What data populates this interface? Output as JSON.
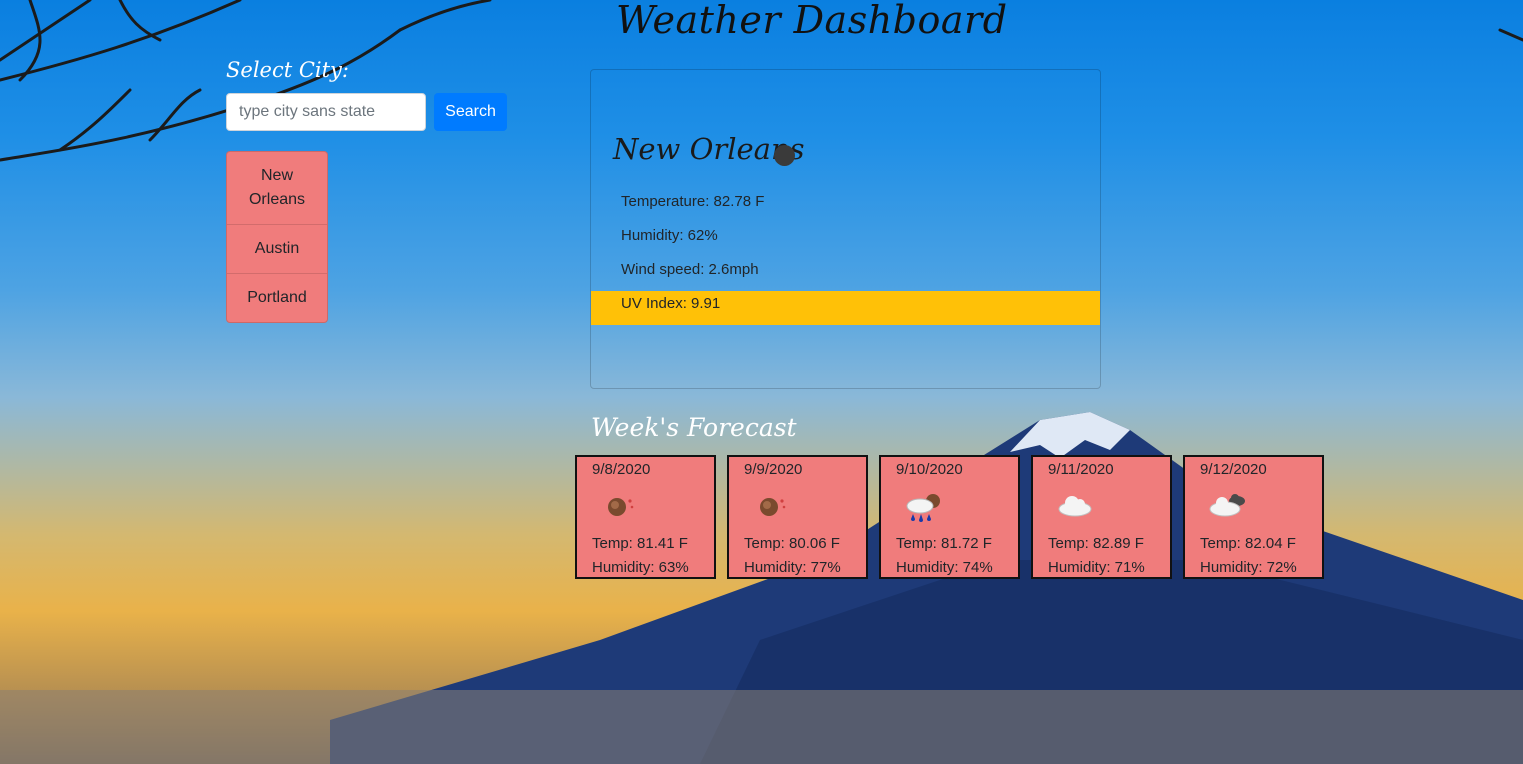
{
  "header": {
    "title": "Weather Dashboard"
  },
  "sidebar": {
    "label": "Select City:",
    "search_placeholder": "type city sans state",
    "search_value": "",
    "search_button": "Search",
    "cities": [
      "New Orleans",
      "Austin",
      "Portland"
    ]
  },
  "current": {
    "city": "New Orleans",
    "icon": "dark-circle-icon",
    "temperature": "Temperature: 82.78 F",
    "humidity": "Humidity: 62%",
    "wind": "Wind speed: 2.6mph",
    "uv": "UV Index: 9.91",
    "uv_color": "#ffc107"
  },
  "forecast": {
    "title": "Week's Forecast",
    "days": [
      {
        "date": "9/8/2020",
        "icon": "haze-icon",
        "temp": "Temp: 81.41 F",
        "humidity": "Humidity: 63%"
      },
      {
        "date": "9/9/2020",
        "icon": "haze-icon",
        "temp": "Temp: 80.06 F",
        "humidity": "Humidity: 77%"
      },
      {
        "date": "9/10/2020",
        "icon": "rain-icon",
        "temp": "Temp: 81.72 F",
        "humidity": "Humidity: 74%"
      },
      {
        "date": "9/11/2020",
        "icon": "cloud-icon",
        "temp": "Temp: 82.89 F",
        "humidity": "Humidity: 71%"
      },
      {
        "date": "9/12/2020",
        "icon": "broken-clouds-icon",
        "temp": "Temp: 82.04 F",
        "humidity": "Humidity: 72%"
      }
    ]
  },
  "colors": {
    "card_bg": "#f07c7c",
    "button": "#007bff",
    "uv_high": "#ffc107"
  }
}
